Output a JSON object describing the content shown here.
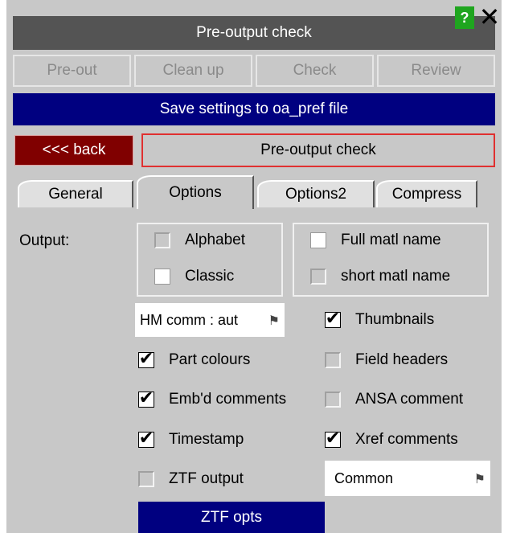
{
  "header": {
    "title": "Pre-output check",
    "help_label": "?",
    "close_label": "✕"
  },
  "toolbar": {
    "items": [
      "Pre-out",
      "Clean up",
      "Check",
      "Review"
    ]
  },
  "save_label": "Save settings to oa_pref file",
  "back_label": "<<< back",
  "mode_label": "Pre-output check",
  "tabs": {
    "items": [
      "General",
      "Options",
      "Options2",
      "Compress"
    ],
    "active": "Options"
  },
  "output_label": "Output:",
  "format_group": {
    "alphabet": "Alphabet",
    "classic": "Classic"
  },
  "matl_group": {
    "full": "Full matl name",
    "short": "short matl name"
  },
  "hm_comm": {
    "value": "HM comm : aut",
    "icon": "flag-icon"
  },
  "options_left": {
    "part_colours": "Part colours",
    "embd_comments": "Emb'd comments",
    "timestamp": "Timestamp",
    "ztf_output": "ZTF output"
  },
  "options_right": {
    "thumbnails": "Thumbnails",
    "field_headers": "Field headers",
    "ansa_comment": "ANSA comment",
    "xref_comments": "Xref comments"
  },
  "common_select": {
    "value": "Common",
    "icon": "flag-icon"
  },
  "ztf_opts_label": "ZTF opts",
  "colors": {
    "panel": "#c8c8c8",
    "title_bar": "#545454",
    "accent_blue": "#000080",
    "back_red": "#800000",
    "help_green": "#1fa51f"
  }
}
